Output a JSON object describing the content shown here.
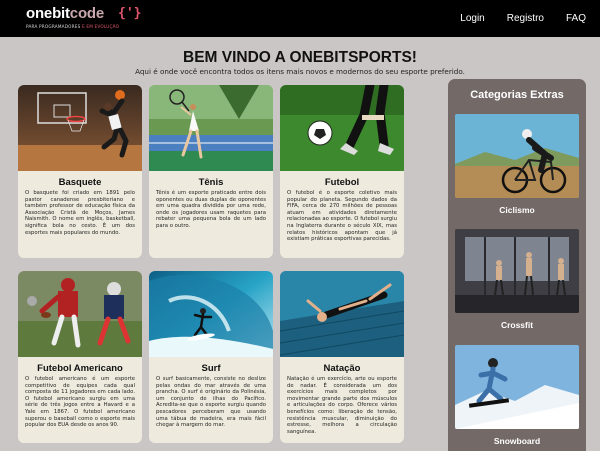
{
  "navbar": {
    "logo_word1": "onebit",
    "logo_word2": "code",
    "logo_brace": "{'}",
    "logo_sub_prefix": "PARA PROGRAMADORES",
    "logo_sub_highlight": "E EM EVOLUÇÃO",
    "links": [
      "Login",
      "Registro",
      "FAQ"
    ]
  },
  "header": {
    "title": "BEM VINDO A ONEBITSPORTS!",
    "subtitle": "Aqui é onde você encontra todos os itens mais novos e modernos do seu esporte preferido."
  },
  "cards": [
    {
      "title": "Basquete",
      "text": "O basquete foi criado em 1891 pelo pastor canadense presbiteriano e também professor de educação física da Associação Cristã de Moços, James Naismith. O nome em inglês, basketball, significa bola no cesto. É um dos esportes mais populares do mundo.",
      "image_icon": "basketball-photo"
    },
    {
      "title": "Tênis",
      "text": "Tênis é um esporte praticado entre dois oponentes ou duas duplas de oponentes em uma quadra dividida por uma rede, onde os jogadores usam raquetes para rebater uma pequena bola de um lado para o outro.",
      "image_icon": "tennis-photo"
    },
    {
      "title": "Futebol",
      "text": "O futebol é o esporte coletivo mais popular do planeta. Segundo dados da FIFA, cerca de 270 milhões de pessoas atuam em atividades diretamente relacionadas ao esporte. O futebol surgiu na Inglaterra durante o século XIX, mas relatos históricos apontam que já existiam práticas esportivas parecidas.",
      "image_icon": "soccer-photo"
    },
    {
      "title": "Futebol Americano",
      "text": "O futebol americano é um esporte competitivo de equipes cada qual composta de 11 jogadores em cada lado. O futebol americano surgiu em uma série de três jogos entre a Havard e a Yale em 1867. O futebol americano superou o baseball como o esporte mais popular dos EUA desde os anos 90.",
      "image_icon": "american-football-photo"
    },
    {
      "title": "Surf",
      "text": "O surf basicamente, consiste no deslize pelas ondas do mar através de uma prancha. O surf é originário da Polinésia, um conjunto de ilhas do Pacífico. Acredita-se que o esporte surgiu quando pescadores perceberam que usando uma tábua de madeira, era mais fácil chegar à margem do mar.",
      "image_icon": "surf-photo"
    },
    {
      "title": "Natação",
      "text": "Natação é um exercício, arte ou esporte de nadar. É considerada um dos exercícios mais completos por movimentar grande parte dos músculos e articulações do corpo. Oferece vários benefícios como: liberação de tensão, resistência muscular, diminuição do estresse, melhora a circulação sanguínea.",
      "image_icon": "swimming-photo"
    }
  ],
  "sidebar": {
    "title": "Categorias Extras",
    "items": [
      {
        "label": "Ciclismo",
        "image_icon": "cycling-photo"
      },
      {
        "label": "Crossfit",
        "image_icon": "crossfit-photo"
      },
      {
        "label": "Snowboard",
        "image_icon": "snowboard-photo"
      }
    ]
  },
  "colors": {
    "navbar_bg": "#000000",
    "page_bg": "#cbc6c6",
    "card_bg": "#eeebde",
    "sidebar_bg": "#736967",
    "logo_accent": "#e0566b"
  }
}
